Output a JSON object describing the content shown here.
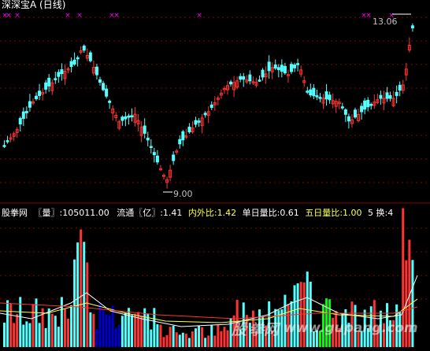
{
  "window_title": "深深宝A (日线)",
  "price_panel": {
    "high_label": "13.06",
    "low_label": "9.00",
    "marker_symbol": "×"
  },
  "indicator_bar": {
    "brand": "股拳网",
    "vol_label": "〖量〗",
    "vol_value": ":105011.00",
    "float_label": "流通〖亿〗",
    "float_value": ":1.41",
    "inout_label": "内外比",
    "inout_value": ":1.42",
    "daily_ratio_label": "单日量比",
    "daily_ratio_value": ":0.61",
    "five_day_ratio_label": "五日量比",
    "five_day_ratio_value": ":1.00",
    "five_label": "5",
    "turnover_label": "换",
    "turnover_value": ":4"
  },
  "watermark": {
    "text_left": "股",
    "text_mid": "拳网",
    "text_url": "www.gupang.com"
  },
  "colors": {
    "up": "#ff3333",
    "down": "#54ffff",
    "grid": "#8b0000",
    "marker": "#ff00ff",
    "white": "#ffffff",
    "yellow": "#ffff54",
    "green": "#00ff00",
    "blue": "#0000cc",
    "ma_red": "#ff3333",
    "bg": "#000000"
  }
}
